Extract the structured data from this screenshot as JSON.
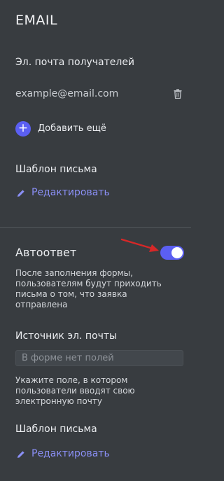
{
  "section_title": "EMAIL",
  "recipients": {
    "label": "Эл. почта получателей",
    "email": "example@email.com",
    "add_label": "Добавить ещё"
  },
  "template1": {
    "label": "Шаблон письма",
    "edit_label": "Редактировать"
  },
  "autoreply": {
    "label": "Автоответ",
    "enabled": true,
    "description_lines": [
      "После заполнения формы,",
      "пользователям будут приходить",
      "письма о том, что заявка",
      "отправлена"
    ]
  },
  "source": {
    "label": "Источник эл. почты",
    "placeholder": "В форме нет полей",
    "hint_lines": [
      "Укажите поле, в котором",
      "пользователи вводят свою",
      "электронную почту"
    ]
  },
  "template2": {
    "label": "Шаблон письма",
    "edit_label": "Редактировать"
  },
  "colors": {
    "background": "#383c40",
    "accent": "#5b5ff2",
    "link": "#8a8ff5",
    "arrow": "#d62828"
  }
}
